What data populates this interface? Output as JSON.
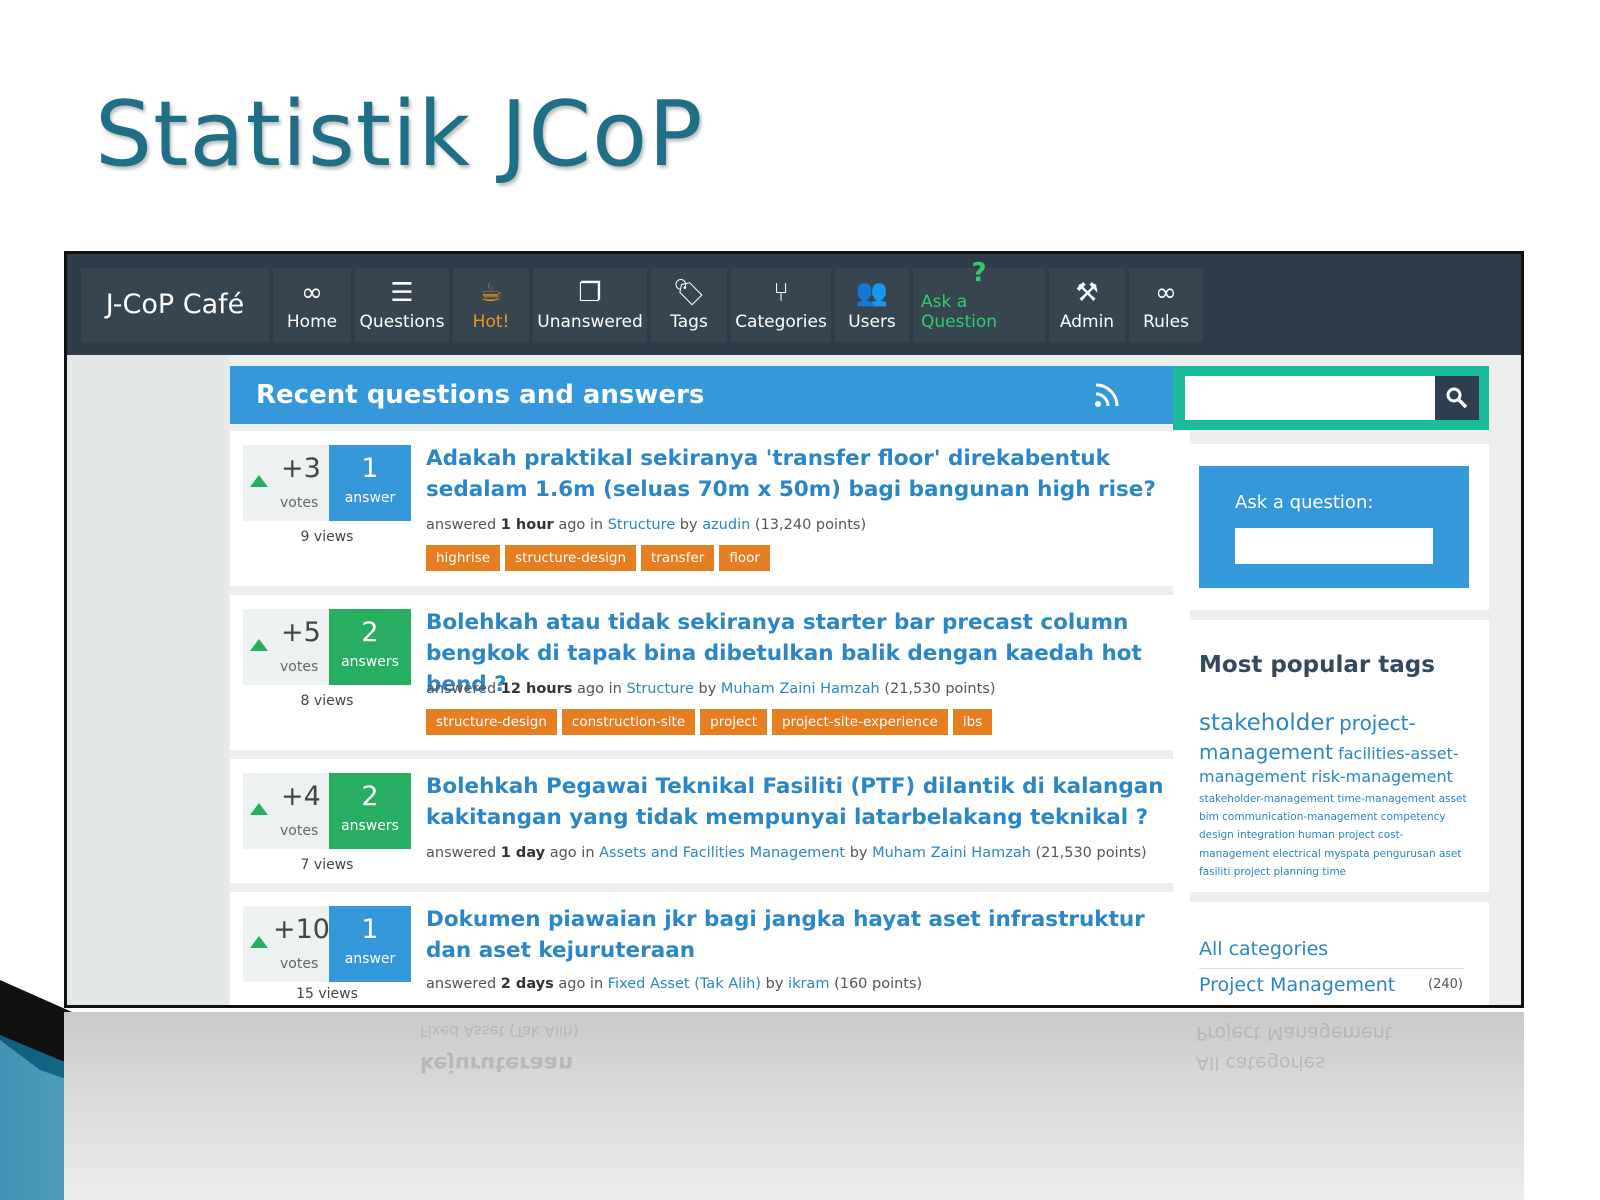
{
  "slide": {
    "title": "Statistik JCoP"
  },
  "brand": {
    "name": "J-CoP Café"
  },
  "nav": {
    "items": [
      {
        "label": "Home",
        "icon": "∞"
      },
      {
        "label": "Questions",
        "icon": "☰"
      },
      {
        "label": "Hot!",
        "icon": "☕"
      },
      {
        "label": "Unanswered",
        "icon": "❐"
      },
      {
        "label": "Tags",
        "icon": "🏷"
      },
      {
        "label": "Categories",
        "icon": "⑂"
      },
      {
        "label": "Users",
        "icon": "👥"
      },
      {
        "label": "Ask a Question",
        "icon": "?"
      },
      {
        "label": "Admin",
        "icon": "⚒"
      },
      {
        "label": "Rules",
        "icon": "∞"
      }
    ]
  },
  "main": {
    "heading": "Recent questions and answers",
    "questions": [
      {
        "votes": "+3",
        "votes_label": "votes",
        "answers": "1",
        "answers_label": "answer",
        "views": "9 views",
        "title": "Adakah praktikal sekiranya 'transfer floor' direkabentuk sedalam 1.6m (seluas 70m x 50m) bagi bangunan high rise?",
        "meta_prefix": "answered",
        "meta_time": "1 hour",
        "meta_ago": "ago in",
        "category": "Structure",
        "meta_by": "by",
        "user": "azudin",
        "points": "(13,240 points)",
        "tags": [
          "highrise",
          "structure-design",
          "transfer",
          "floor"
        ]
      },
      {
        "votes": "+5",
        "votes_label": "votes",
        "answers": "2",
        "answers_label": "answers",
        "views": "8 views",
        "title": "Bolehkah atau tidak sekiranya starter bar precast column bengkok di tapak bina dibetulkan balik dengan kaedah hot bend ?",
        "meta_prefix": "answered",
        "meta_time": "12 hours",
        "meta_ago": "ago in",
        "category": "Structure",
        "meta_by": "by",
        "user": "Muham Zaini Hamzah",
        "points": "(21,530 points)",
        "tags": [
          "structure-design",
          "construction-site",
          "project",
          "project-site-experience",
          "ibs"
        ]
      },
      {
        "votes": "+4",
        "votes_label": "votes",
        "answers": "2",
        "answers_label": "answers",
        "views": "7 views",
        "title": "Bolehkah Pegawai Teknikal Fasiliti (PTF) dilantik di kalangan kakitangan yang tidak mempunyai latarbelakang teknikal ?",
        "meta_prefix": "answered",
        "meta_time": "1 day",
        "meta_ago": "ago in",
        "category": "Assets and Facilities Management",
        "meta_by": "by",
        "user": "Muham Zaini Hamzah",
        "points": "(21,530 points)",
        "tags": []
      },
      {
        "votes": "+10",
        "votes_label": "votes",
        "answers": "1",
        "answers_label": "answer",
        "views": "15 views",
        "title": "Dokumen piawaian jkr bagi jangka hayat aset infrastruktur dan aset kejuruteraan",
        "meta_prefix": "answered",
        "meta_time": "2 days",
        "meta_ago": "ago in",
        "category": "Fixed Asset (Tak Alih)",
        "meta_by": "by",
        "user": "ikram",
        "points": "(160 points)",
        "tags": []
      }
    ]
  },
  "sidebar": {
    "search": {
      "placeholder": "",
      "button_icon": "search-icon"
    },
    "ask": {
      "label": "Ask a question:",
      "placeholder": ""
    },
    "popular": {
      "title": "Most popular tags",
      "tags_xl": [
        "stakeholder"
      ],
      "tags_l": [
        "project-",
        "management"
      ],
      "tags_m": [
        "facilities-asset-",
        "management",
        "risk-management"
      ],
      "tags_s": "stakeholder-management time-management asset bim communication-management competency design integration human project cost-management electrical myspata pengurusan aset fasiliti project planning time"
    },
    "categories": {
      "all": "All categories",
      "first": "Project Management",
      "first_count": "(240)"
    }
  },
  "colors": {
    "title": "#1f6f86",
    "topbar": "#2f3d4a",
    "header_blue": "#3498db",
    "answer_green": "#27ae60",
    "tag_orange": "#e67e22",
    "search_teal": "#1abc9c"
  }
}
